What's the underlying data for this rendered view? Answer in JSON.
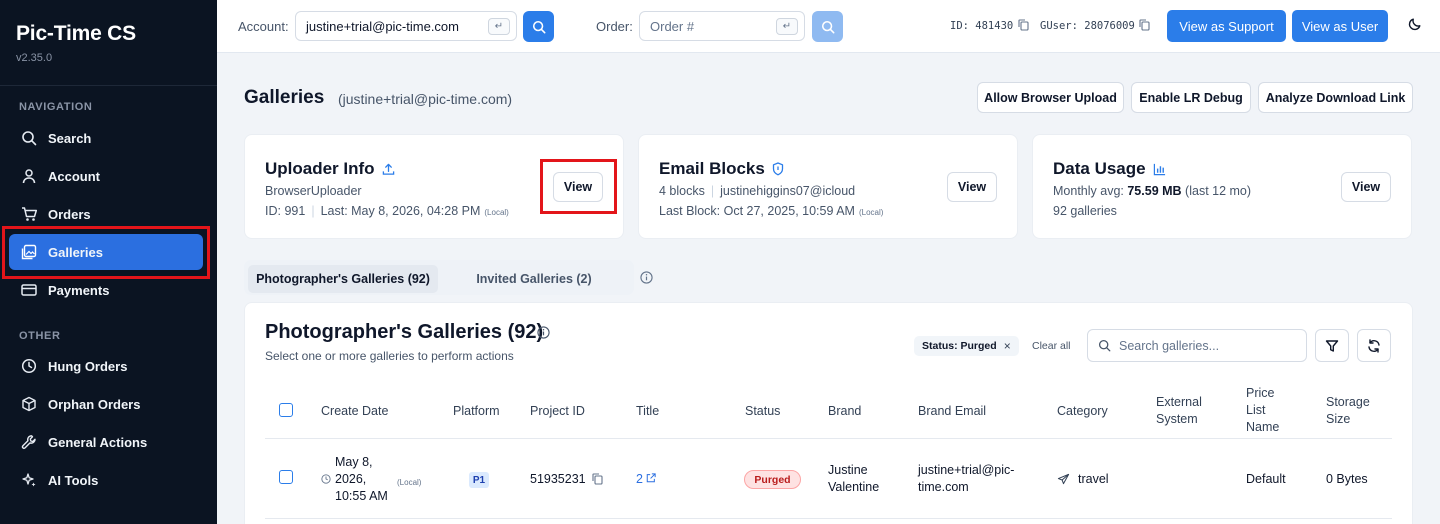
{
  "sidebar": {
    "brand": "Pic-Time CS",
    "version": "v2.35.0",
    "nav_section": "NAVIGATION",
    "other_section": "OTHER",
    "nav_items": [
      {
        "label": "Search",
        "icon": "search-icon"
      },
      {
        "label": "Account",
        "icon": "user-icon"
      },
      {
        "label": "Orders",
        "icon": "cart-icon"
      },
      {
        "label": "Galleries",
        "icon": "gallery-icon",
        "active": true
      },
      {
        "label": "Payments",
        "icon": "credit-card-icon"
      }
    ],
    "other_items": [
      {
        "label": "Hung Orders",
        "icon": "clock-icon"
      },
      {
        "label": "Orphan Orders",
        "icon": "box-icon"
      },
      {
        "label": "General Actions",
        "icon": "wrench-icon"
      },
      {
        "label": "AI Tools",
        "icon": "sparkles-icon"
      }
    ]
  },
  "topbar": {
    "account_label": "Account:",
    "account_value": "justine+trial@pic-time.com",
    "order_label": "Order:",
    "order_placeholder": "Order #",
    "enter_glyph": "↵",
    "id_text": "ID: 481430",
    "guser_text": "GUser: 28076009",
    "view_support": "View as Support",
    "view_user": "View as User"
  },
  "header": {
    "title": "Galleries",
    "subtitle": "(justine+trial@pic-time.com)",
    "actions": [
      "Allow Browser Upload",
      "Enable LR Debug",
      "Analyze Download Link"
    ]
  },
  "cards": {
    "uploader": {
      "title": "Uploader Info",
      "line1": "BrowserUploader",
      "line2_id": "ID: 991",
      "line2_last": "Last: May 8, 2026, 04:28 PM",
      "local": "(Local)",
      "view": "View"
    },
    "email": {
      "title": "Email Blocks",
      "line1_blocks": "4 blocks",
      "line1_email": "justinehiggins07@icloud",
      "line2": "Last Block: Oct 27, 2025, 10:59 AM",
      "local": "(Local)",
      "view": "View"
    },
    "data": {
      "title": "Data Usage",
      "line1_label": "Monthly avg:",
      "line1_value": "75.59 MB",
      "line1_suffix": "(last 12 mo)",
      "line2": "92 galleries",
      "view": "View"
    }
  },
  "tabs": [
    {
      "label": "Photographer's Galleries (92)",
      "active": true
    },
    {
      "label": "Invited Galleries (2)",
      "active": false
    }
  ],
  "panel": {
    "title": "Photographer's Galleries (92)",
    "subtitle": "Select one or more galleries to perform actions",
    "chip": "Status: Purged",
    "chip_close": "×",
    "clear_all": "Clear all",
    "search_placeholder": "Search galleries..."
  },
  "table": {
    "headers": {
      "create_date": "Create Date",
      "platform": "Platform",
      "project_id": "Project ID",
      "title": "Title",
      "status": "Status",
      "brand": "Brand",
      "brand_email": "Brand Email",
      "category": "Category",
      "external_system": "External System",
      "price_list": "Price List Name",
      "storage": "Storage Size"
    },
    "rows": [
      {
        "date_line1": "May 8,",
        "date_line2": "2026,",
        "date_line3": "10:55 AM",
        "local": "(Local)",
        "platform": "P1",
        "project_id": "51935231",
        "title": "2",
        "status": "Purged",
        "brand": "Justine Valentine",
        "brand_email": "justine+trial@pic-time.com",
        "category": "travel",
        "external_system": "",
        "price_list": "Default",
        "storage": "0 Bytes"
      }
    ]
  },
  "colors": {
    "sidebar_bg": "#0b1422",
    "accent": "#2b7de9",
    "highlight": "#e3151a",
    "purged": "#b91c1c"
  }
}
